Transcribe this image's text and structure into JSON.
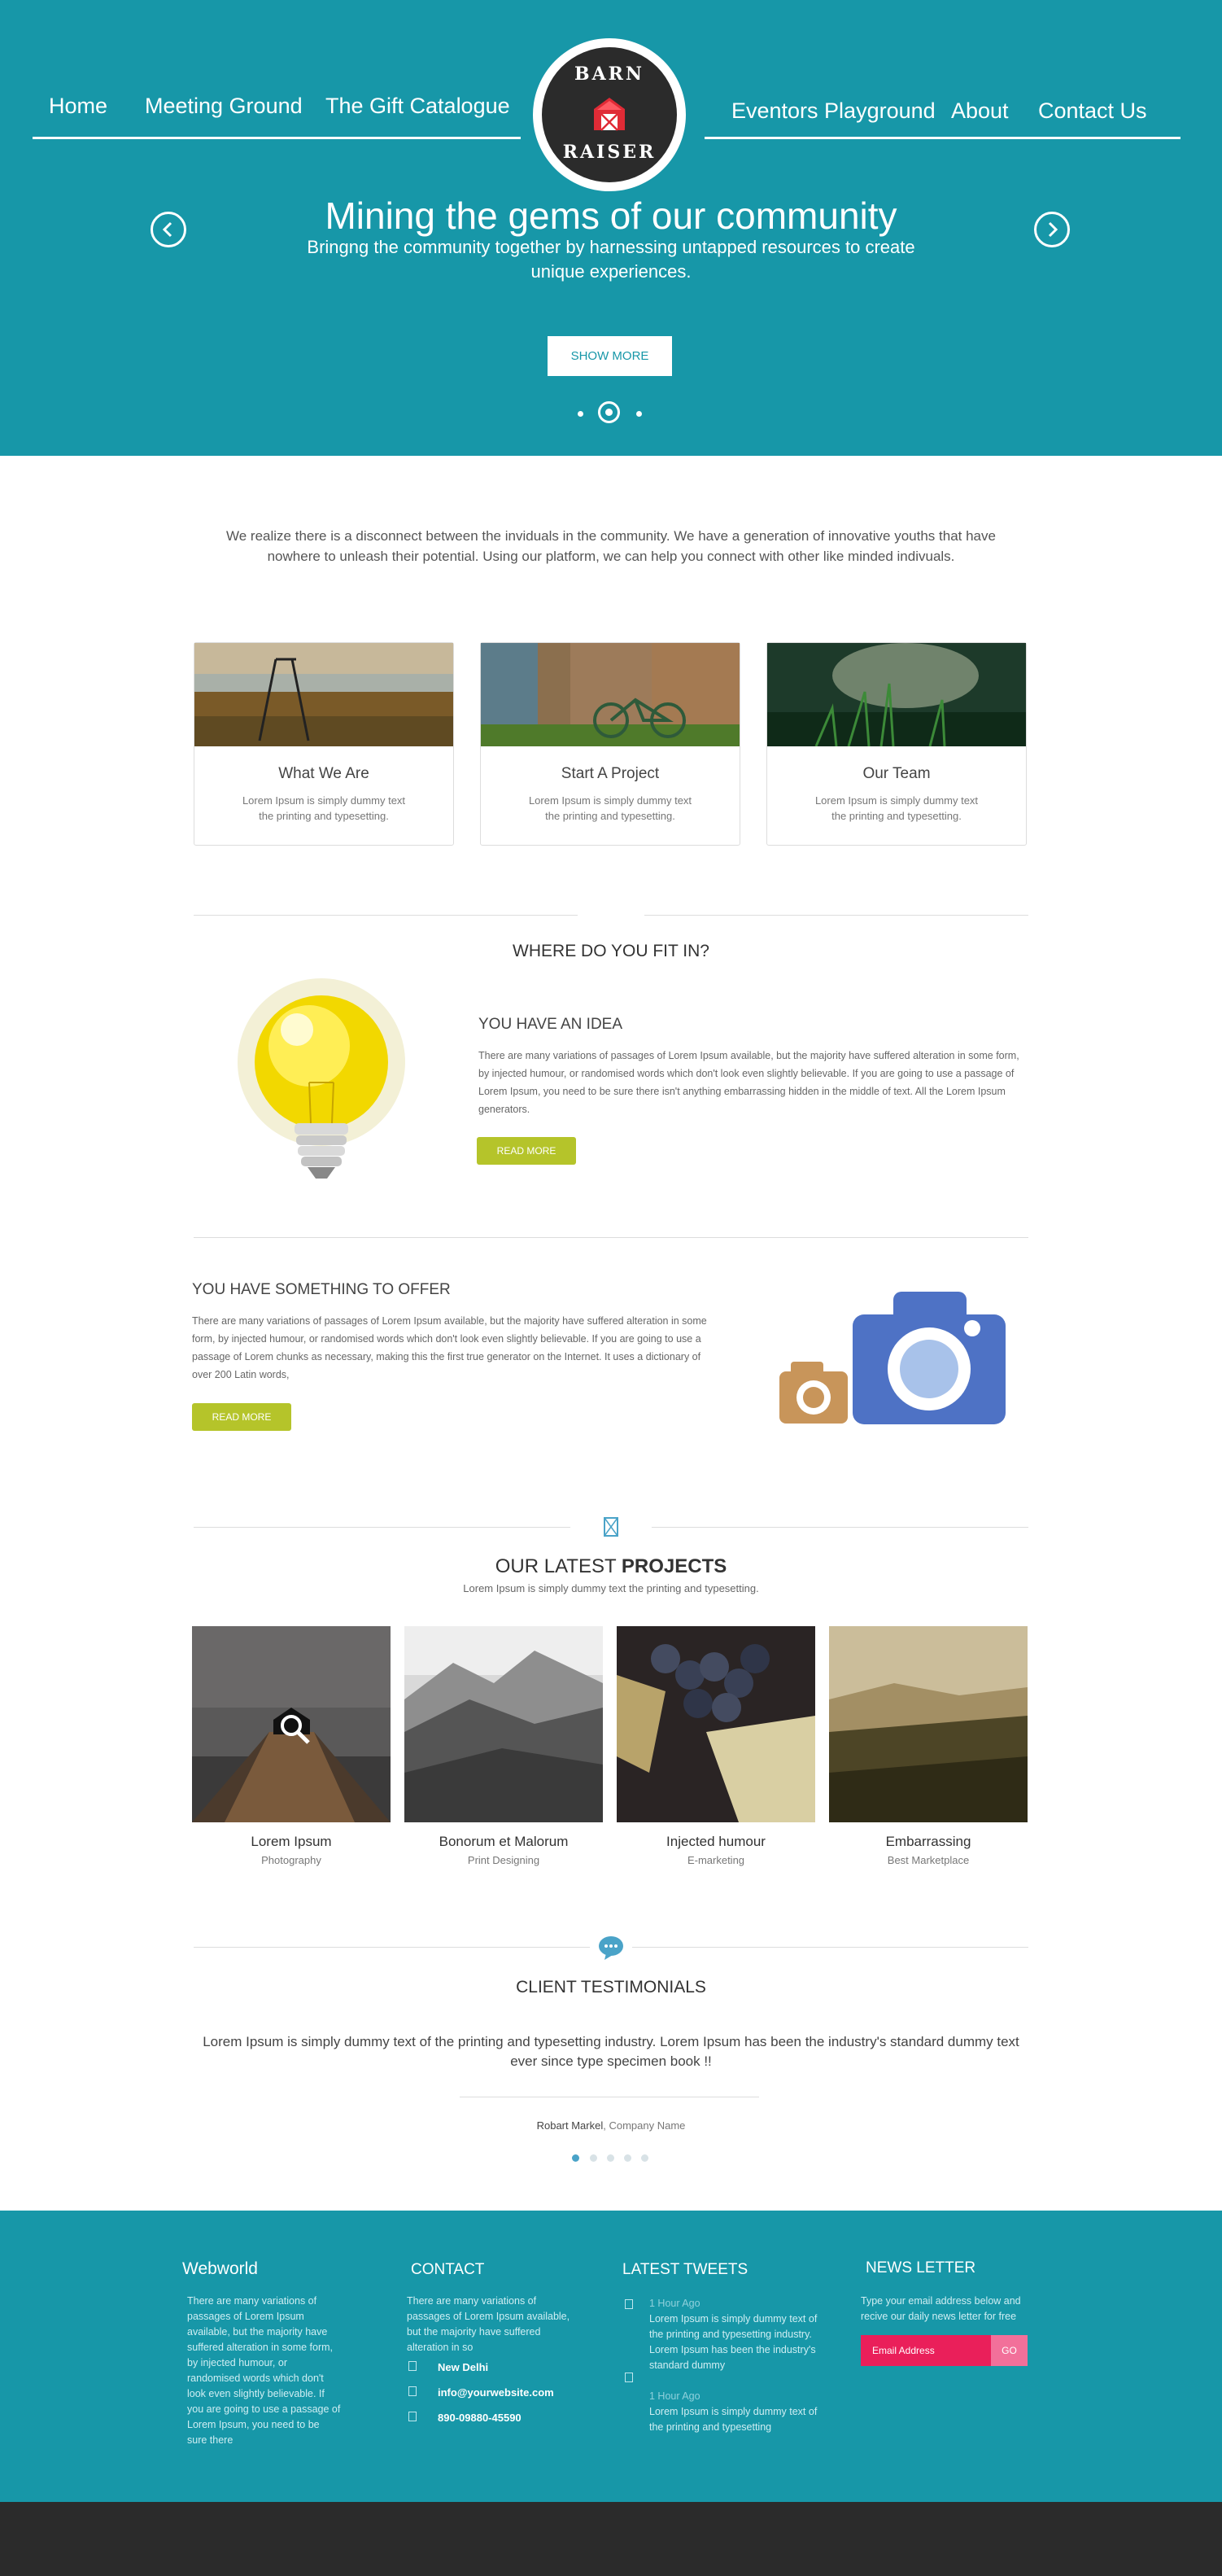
{
  "nav": {
    "left": [
      "Home",
      "Meeting Ground",
      "The Gift  Catalogue"
    ],
    "right": [
      "Eventors Playground",
      "About",
      "Contact Us"
    ]
  },
  "logo": {
    "top": "BARN",
    "bottom": "RAISER"
  },
  "hero": {
    "title": "Mining the gems of our community",
    "subtitle": "Bringng the community together by harnessing untapped resources to create unique experiences.",
    "button": "SHOW MORE",
    "slides": 3,
    "active_slide": 2
  },
  "intro": "We realize there is a disconnect between the inviduals in the community. We have a generation of innovative youths that have nowhere to unleash their potential.  Using our platform, we can help you connect with other like minded  indivuals.",
  "cards": [
    {
      "title": "What We Are",
      "text": "Lorem Ipsum is simply dummy text the printing and typesetting."
    },
    {
      "title": "Start A Project",
      "text": "Lorem Ipsum is simply dummy text the printing and typesetting."
    },
    {
      "title": "Our Team",
      "text": "Lorem Ipsum is simply dummy text the printing and typesetting."
    }
  ],
  "fit": {
    "title": "WHERE DO YOU FIT IN?",
    "idea_heading": "YOU HAVE AN IDEA",
    "idea_text": "There are many variations of passages of Lorem Ipsum available, but the majority have suffered alteration in some form, by injected humour, or randomised words which don't look even slightly believable. If you are going to use a passage of Lorem Ipsum, you need to be sure there isn't anything embarrassing hidden in the middle of text. All the Lorem Ipsum generators.",
    "idea_button": "READ MORE",
    "offer_heading": "YOU HAVE SOMETHING TO OFFER",
    "offer_text": "There are many variations of passages of Lorem Ipsum available, but the majority have suffered alteration in some form, by injected humour, or randomised words which don't look even slightly believable. If you are going to use a passage of Lorem chunks as necessary, making this the first true generator on the Internet. It uses a dictionary of over 200 Latin words,",
    "offer_button": "READ MORE"
  },
  "projects": {
    "title_light": "OUR LATEST ",
    "title_bold": "PROJECTS",
    "subtitle": "Lorem Ipsum is simply dummy text the printing and typesetting.",
    "items": [
      {
        "title": "Lorem Ipsum",
        "category": "Photography"
      },
      {
        "title": "Bonorum et Malorum",
        "category": "Print Designing"
      },
      {
        "title": "Injected humour",
        "category": "E-marketing"
      },
      {
        "title": "Embarrassing",
        "category": "Best Marketplace"
      }
    ]
  },
  "testimonials": {
    "title": "CLIENT TESTIMONIALS",
    "quote": "Lorem Ipsum is simply dummy text of the printing and typesetting industry. Lorem Ipsum has been the industry's standard dummy text ever since type specimen book !!",
    "author": "Robart Markel",
    "company": ", Company Name",
    "dots": 5,
    "active_dot": 1
  },
  "footer": {
    "brand": "Webworld",
    "brand_text": "There are many variations of passages of Lorem Ipsum available, but the majority have suffered alteration in some form, by injected humour, or randomised words which don't look even slightly believable. If you are going to use a passage of Lorem Ipsum, you need to be sure there",
    "contact_head": "CONTACT",
    "contact_text": "There are many variations of passages of Lorem Ipsum available, but the majority have suffered alteration in so",
    "city": "New Delhi",
    "email": "info@yourwebsite.com",
    "phone": "890-09880-45590",
    "tweets_head": "LATEST TWEETS",
    "tweets": [
      {
        "time": "1 Hour Ago",
        "text": "Lorem Ipsum is simply dummy text of the printing and typesetting industry. Lorem Ipsum has been the industry's standard dummy"
      },
      {
        "time": "1 Hour Ago",
        "text": "Lorem Ipsum is simply dummy text of the printing and typesetting"
      }
    ],
    "news_head": "NEWS LETTER",
    "news_text": "Type your email address below and recive our daily news letter for free",
    "email_placeholder": "Email Address",
    "go": "GO"
  },
  "colors": {
    "teal": "#1797a8",
    "lime": "#b5c42a",
    "pink": "#ea1f5a",
    "dark": "#2b2b2b"
  }
}
